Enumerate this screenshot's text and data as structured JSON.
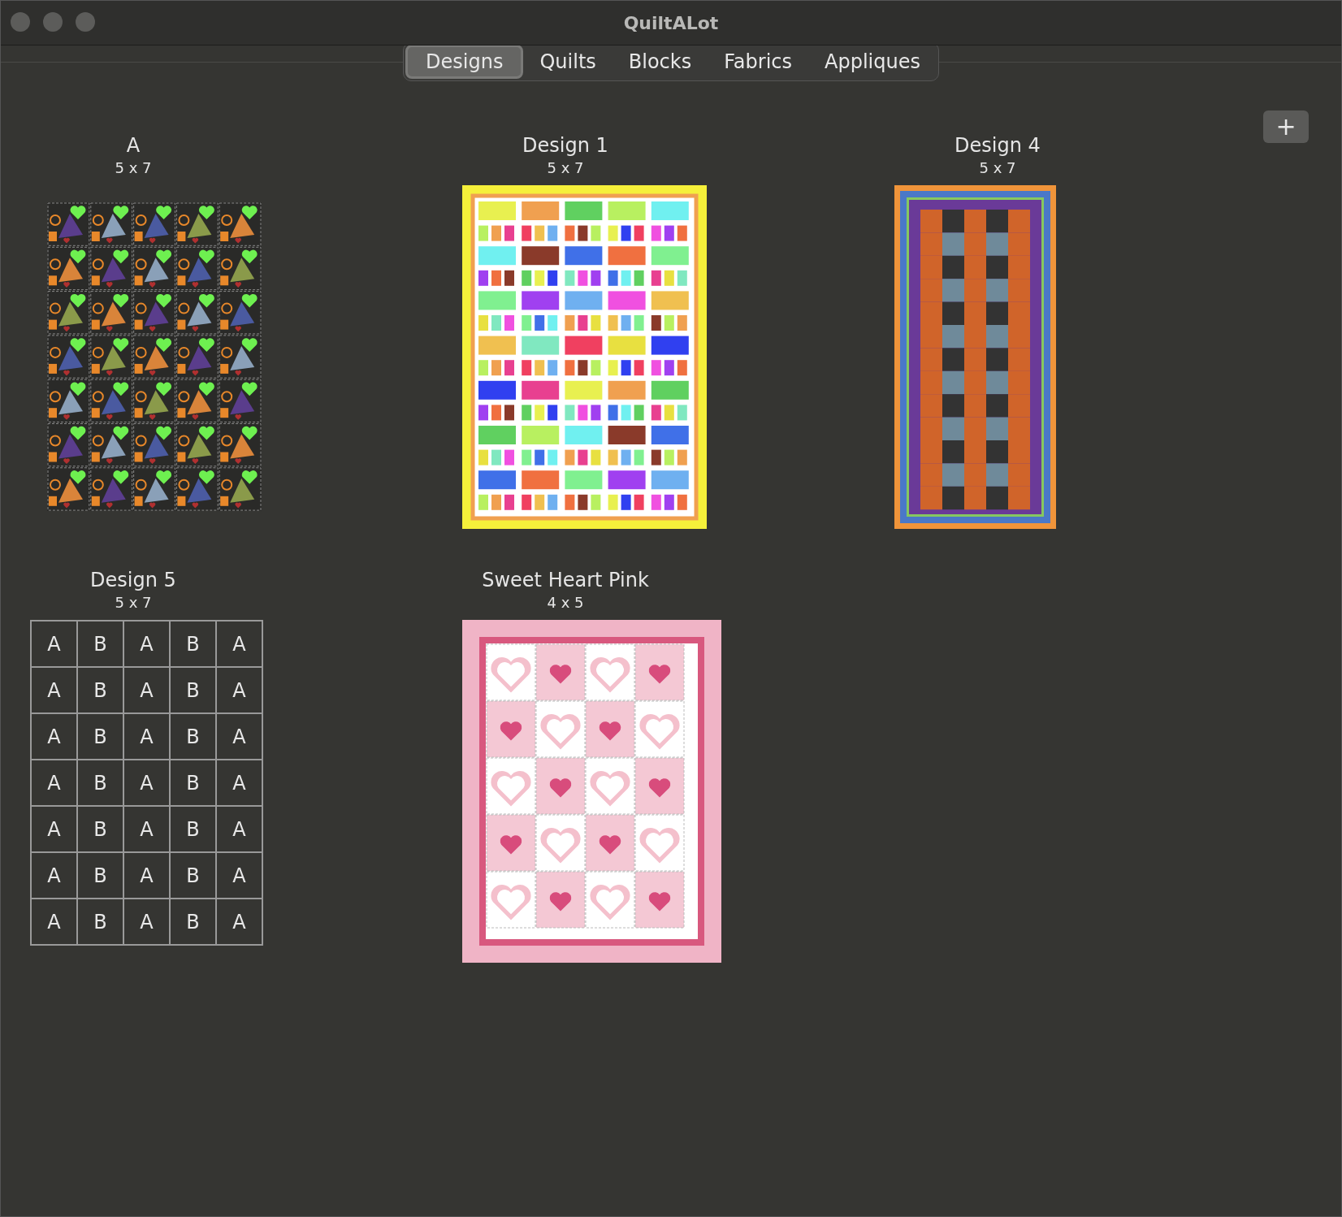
{
  "window": {
    "title": "QuiltALot"
  },
  "tabs": [
    {
      "label": "Designs",
      "selected": true
    },
    {
      "label": "Quilts",
      "selected": false
    },
    {
      "label": "Blocks",
      "selected": false
    },
    {
      "label": "Fabrics",
      "selected": false
    },
    {
      "label": "Appliques",
      "selected": false
    }
  ],
  "add_button": {
    "label": "+"
  },
  "designs": [
    {
      "name": "A",
      "size": "5 x 7",
      "kind": "fabric-pattern"
    },
    {
      "name": "Design 1",
      "size": "5 x 7",
      "kind": "color-blocks"
    },
    {
      "name": "Design 4",
      "size": "5 x 7",
      "kind": "strip-columns"
    },
    {
      "name": "Design 5",
      "size": "5 x 7",
      "kind": "letter-grid",
      "grid": [
        [
          "A",
          "B",
          "A",
          "B",
          "A"
        ],
        [
          "A",
          "B",
          "A",
          "B",
          "A"
        ],
        [
          "A",
          "B",
          "A",
          "B",
          "A"
        ],
        [
          "A",
          "B",
          "A",
          "B",
          "A"
        ],
        [
          "A",
          "B",
          "A",
          "B",
          "A"
        ],
        [
          "A",
          "B",
          "A",
          "B",
          "A"
        ],
        [
          "A",
          "B",
          "A",
          "B",
          "A"
        ]
      ]
    },
    {
      "name": "Sweet Heart Pink",
      "size": "4 x 5",
      "kind": "hearts"
    }
  ]
}
